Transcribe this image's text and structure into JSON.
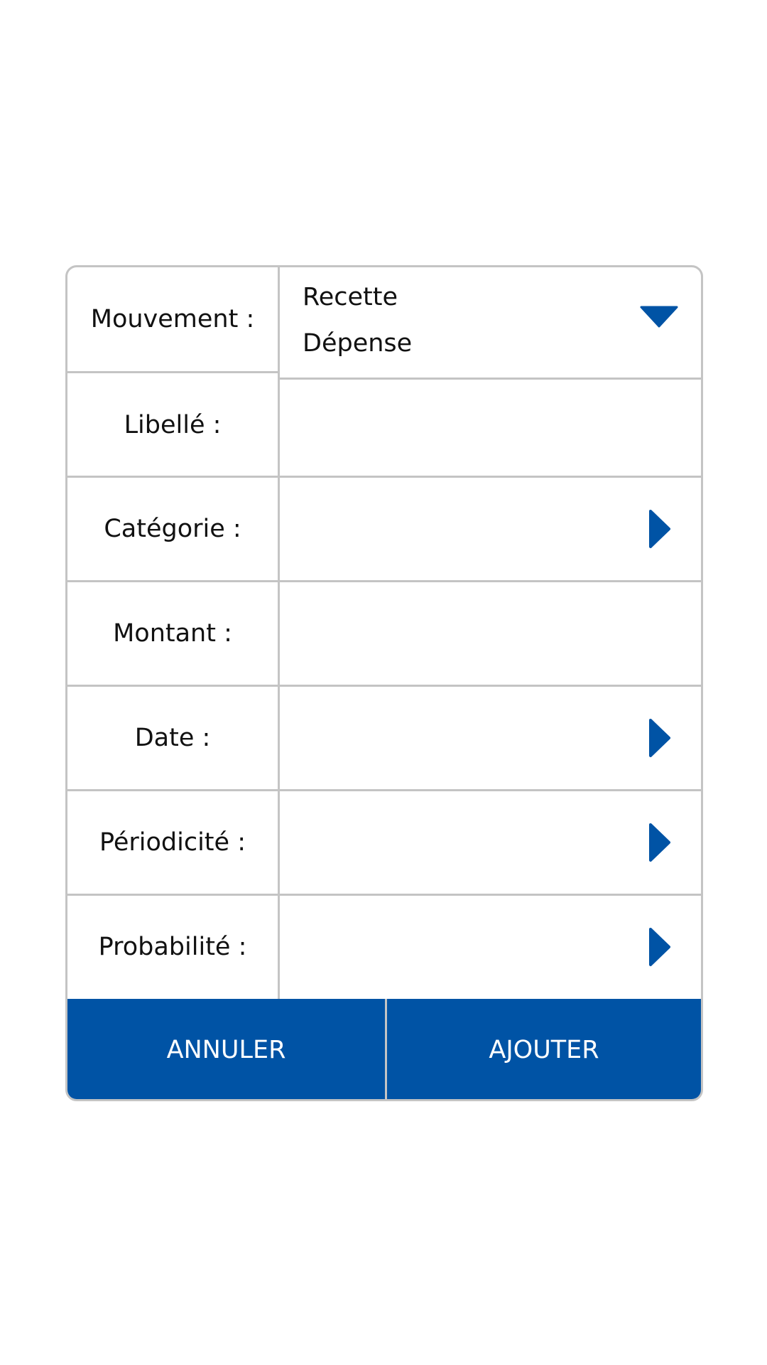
{
  "form": {
    "rows": [
      {
        "label": "Mouvement :"
      },
      {
        "label": "Libellé :"
      },
      {
        "label": "Catégorie :"
      },
      {
        "label": "Montant :"
      },
      {
        "label": "Date :"
      },
      {
        "label": "Périodicité :"
      },
      {
        "label": "Probabilité :"
      }
    ],
    "mouvement_options": [
      "Recette",
      "Dépense"
    ],
    "libelle_value": "",
    "montant_value": ""
  },
  "buttons": {
    "cancel_label": "ANNULER",
    "add_label": "AJOUTER"
  },
  "colors": {
    "accent": "#0053a5",
    "border": "#c4c4c4",
    "text": "#111111",
    "button_text": "#ffffff"
  },
  "icons": {
    "dropdown": "chevron-down-icon",
    "navigate": "chevron-right-icon"
  }
}
